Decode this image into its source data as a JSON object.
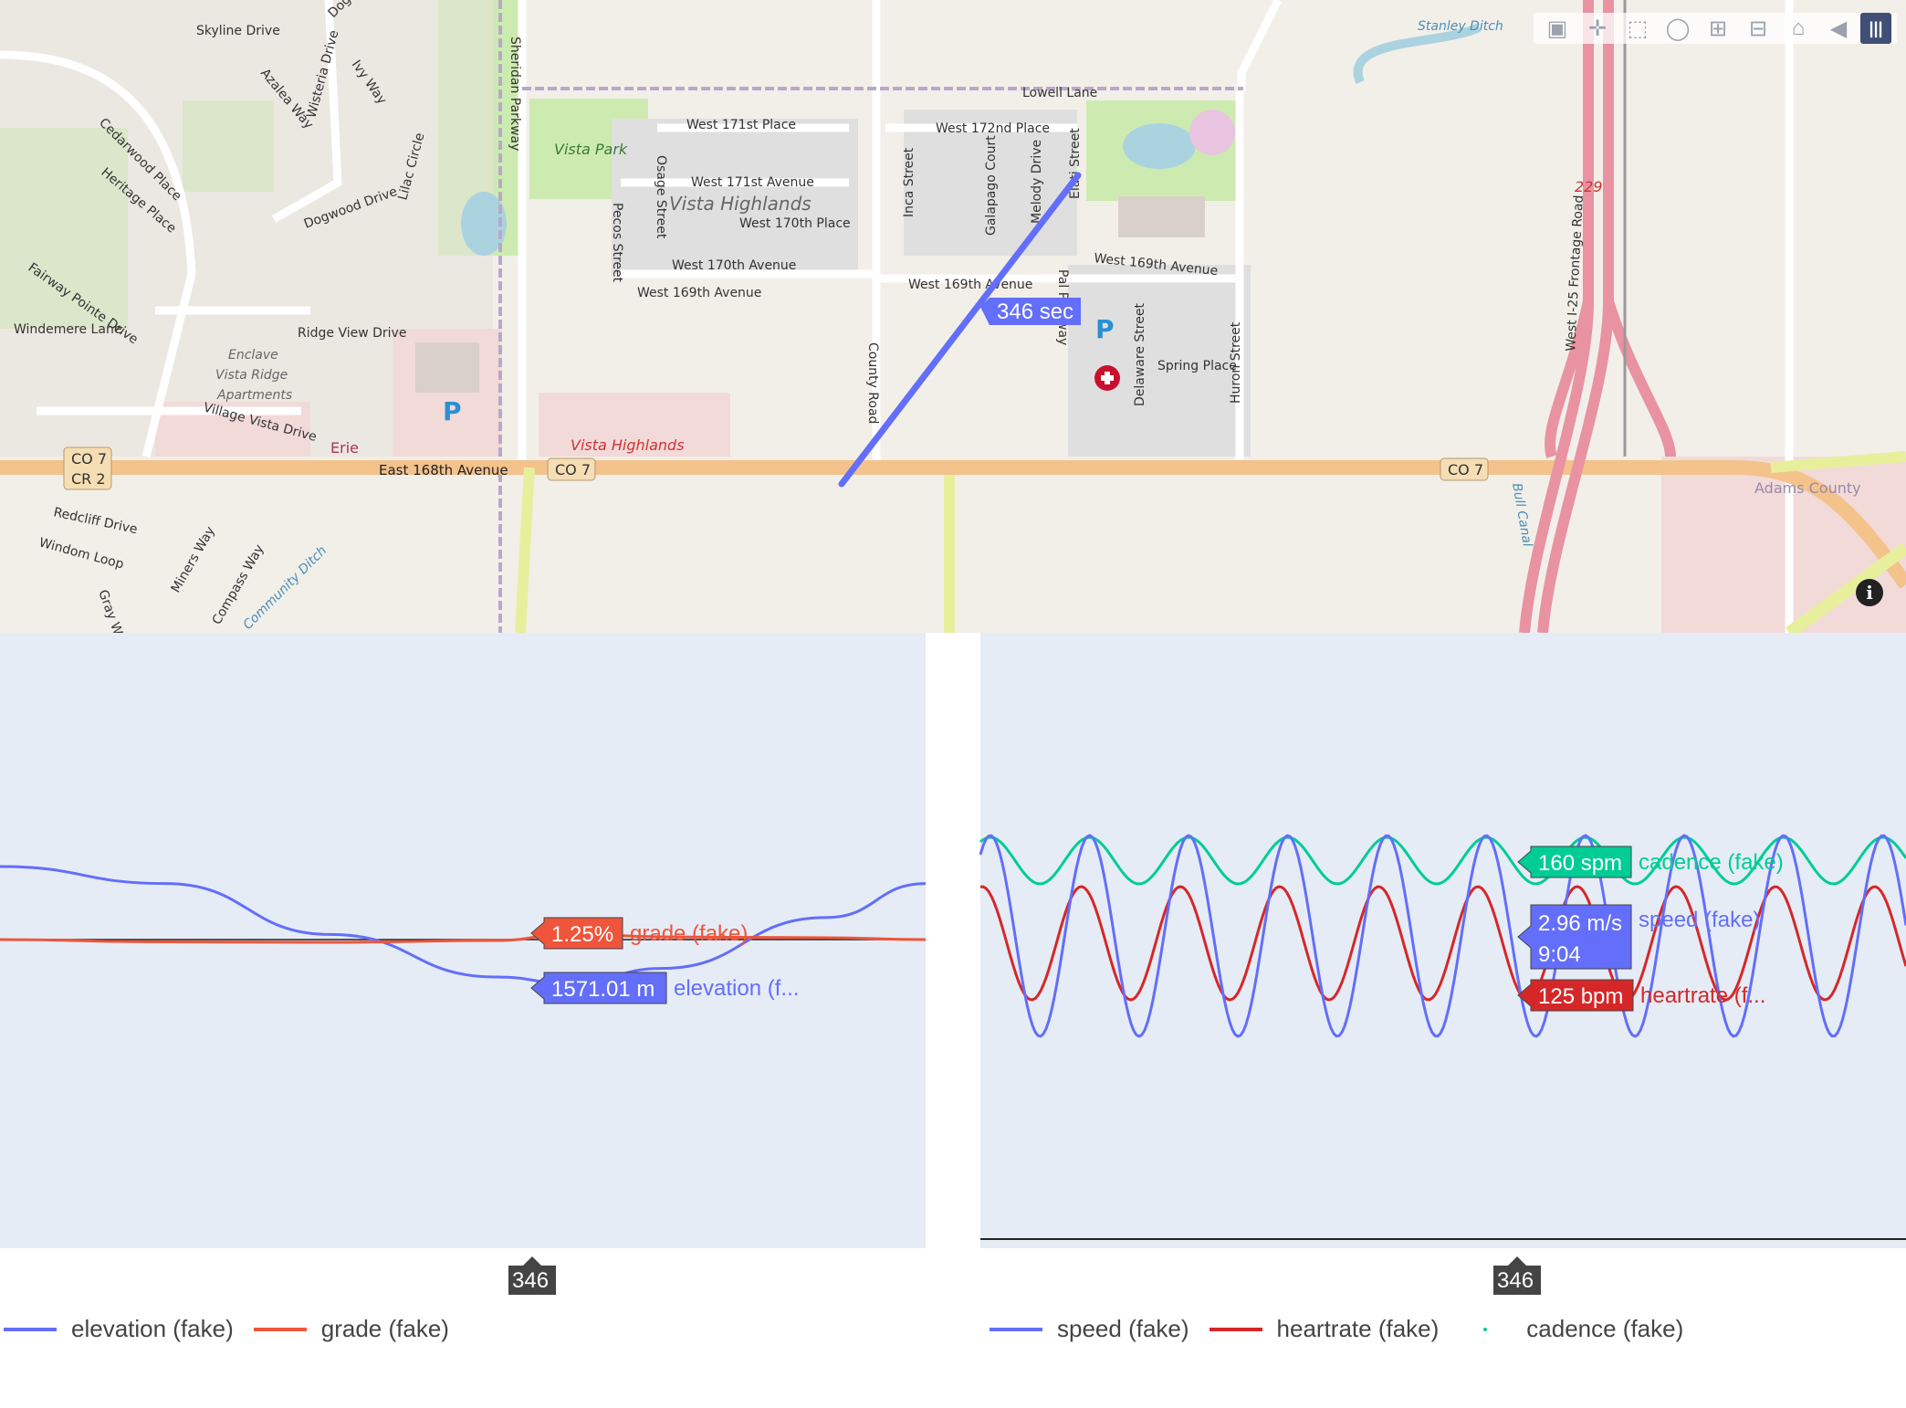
{
  "map": {
    "hover_label": "346 sec",
    "route_color": "#636efa",
    "labels": [
      {
        "t": "Skyline Drive"
      },
      {
        "t": "Sheridan Parkway"
      },
      {
        "t": "Vista Park"
      },
      {
        "t": "West 171st Place"
      },
      {
        "t": "West 172nd Place"
      },
      {
        "t": "Lowell Lane"
      },
      {
        "t": "Vista Highlands"
      },
      {
        "t": "West 171st Avenue"
      },
      {
        "t": "West 170th Place"
      },
      {
        "t": "West 170th Avenue"
      },
      {
        "t": "West 169th Avenue"
      },
      {
        "t": "West 169th Avenue"
      },
      {
        "t": "West 169th Avenue"
      },
      {
        "t": "Ridge View Drive"
      },
      {
        "t": "Enclave"
      },
      {
        "t": "Vista Ridge"
      },
      {
        "t": "Apartments"
      },
      {
        "t": "Village Vista Drive"
      },
      {
        "t": "Erie"
      },
      {
        "t": "East 168th Avenue"
      },
      {
        "t": "Vista Highlands"
      },
      {
        "t": "County Road"
      },
      {
        "t": "Spring Place"
      },
      {
        "t": "Delaware Street"
      },
      {
        "t": "Huron Street"
      },
      {
        "t": "Adams County"
      },
      {
        "t": "Redcliff Drive"
      },
      {
        "t": "Windom Loop"
      },
      {
        "t": "Miners Way"
      },
      {
        "t": "Compass Way"
      },
      {
        "t": "Community Ditch"
      },
      {
        "t": "Dogwood Drive"
      },
      {
        "t": "Heritage Place"
      },
      {
        "t": "Cedarwood Place"
      },
      {
        "t": "Fairway Pointe Drive"
      },
      {
        "t": "Windemere Lane"
      },
      {
        "t": "Azalea Way"
      },
      {
        "t": "Wisteria Drive"
      },
      {
        "t": "Lilac Circle"
      },
      {
        "t": "Ivy Way"
      },
      {
        "t": "Osage Street"
      },
      {
        "t": "Pecos Street"
      },
      {
        "t": "Inca Street"
      },
      {
        "t": "Galapago Court"
      },
      {
        "t": "Melody Drive"
      },
      {
        "t": "Elati Street"
      },
      {
        "t": "West I-25 Frontage Road"
      },
      {
        "t": "Bull Canal"
      },
      {
        "t": "Stanley Ditch"
      },
      {
        "t": "Gray Wolf"
      },
      {
        "t": "Pal Parkway"
      },
      {
        "t": "Dogwood Circle"
      }
    ],
    "shields": [
      {
        "t": "CO 7"
      },
      {
        "t": "CR 2"
      },
      {
        "t": "CO 7"
      },
      {
        "t": "CO 7"
      },
      {
        "t": "229"
      }
    ],
    "parking": "P",
    "info": "i"
  },
  "modebar": {
    "icons": [
      "camera-icon",
      "pan-icon",
      "box-select-icon",
      "lasso-icon",
      "zoom-in-icon",
      "zoom-out-icon",
      "reset-icon",
      "toggle-hover-icon",
      "plotly-logo-icon"
    ]
  },
  "chart_data": [
    {
      "type": "line",
      "series": [
        {
          "name": "elevation (fake)",
          "color": "#636efa",
          "unit": "m",
          "x": [
            0,
            100,
            200,
            300,
            346,
            400,
            500,
            560
          ],
          "y": [
            1571.7,
            1571.6,
            1571.3,
            1571.05,
            1571.01,
            1571.1,
            1571.4,
            1571.6
          ]
        },
        {
          "name": "grade (fake)",
          "color": "#ef553b",
          "unit": "%",
          "x": [
            0,
            100,
            200,
            300,
            346,
            400,
            500,
            560
          ],
          "y": [
            0.0,
            -0.5,
            -0.6,
            -0.2,
            1.25,
            0.6,
            0.4,
            0.0
          ]
        }
      ],
      "hover": {
        "x_label": "346",
        "elevation_label": "1571.01 m",
        "elevation_name": "elevation (f...",
        "grade_label": "1.25%",
        "grade_name": "grade (fake)"
      },
      "legend": [
        "elevation (fake)",
        "grade (fake)"
      ],
      "grid": false
    },
    {
      "type": "line",
      "series": [
        {
          "name": "speed (fake)",
          "color": "#636efa",
          "unit": "m/s",
          "mean": 3.0,
          "amplitude": 0.9,
          "period_s": 60
        },
        {
          "name": "heartrate (fake)",
          "color": "#d62728",
          "unit": "bpm",
          "mean": 140,
          "amplitude": 15,
          "period_s": 60
        },
        {
          "name": "cadence (fake)",
          "color": "#00cc96",
          "unit": "spm",
          "mean": 165,
          "amplitude": 5,
          "period_s": 60
        }
      ],
      "hover": {
        "x_label": "346",
        "cadence_label": "160 spm",
        "cadence_name": "cadence (fake)",
        "speed_label": "2.96 m/s",
        "pace_label": "9:04",
        "speed_name": "speed (fake)",
        "heartrate_label": "125 bpm",
        "heartrate_name": "heartrate (f..."
      },
      "legend": [
        "speed (fake)",
        "heartrate (fake)",
        "cadence (fake)"
      ],
      "grid": false
    }
  ],
  "legend_left": [
    {
      "label": "elevation (fake)",
      "color": "#636efa"
    },
    {
      "label": "grade (fake)",
      "color": "#ef553b"
    }
  ],
  "legend_right": [
    {
      "label": "speed (fake)",
      "color": "#636efa"
    },
    {
      "label": "heartrate (fake)",
      "color": "#d62728"
    },
    {
      "label": "cadence (fake)",
      "color": "#00cc96"
    }
  ]
}
